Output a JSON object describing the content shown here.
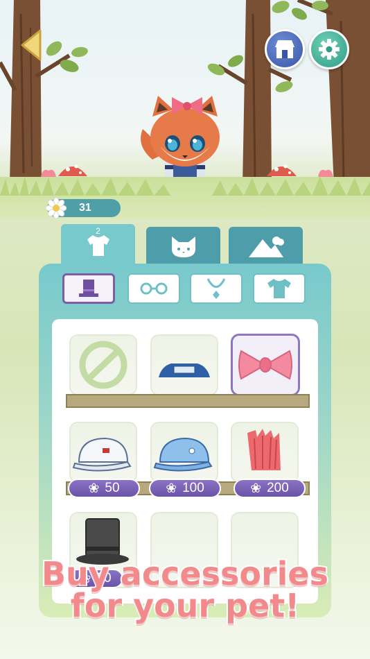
{
  "hud": {
    "coin_count": "31",
    "back_icon": "back-arrow-icon",
    "shop_icon": "shop-icon",
    "settings_icon": "gear-icon"
  },
  "category_tabs": [
    {
      "name": "clothing",
      "icon": "shirt-icon",
      "badge": "2",
      "active": true
    },
    {
      "name": "pet",
      "icon": "cat-face-icon",
      "active": false
    },
    {
      "name": "background",
      "icon": "mountain-icon",
      "active": false
    }
  ],
  "subtabs": [
    {
      "name": "hats",
      "icon": "top-hat-icon",
      "active": true
    },
    {
      "name": "glasses",
      "icon": "glasses-icon",
      "active": false
    },
    {
      "name": "necklaces",
      "icon": "necklace-icon",
      "active": false
    },
    {
      "name": "shirts",
      "icon": "tshirt-icon",
      "active": false
    }
  ],
  "items": [
    {
      "name": "none",
      "icon": "none-icon",
      "price": null
    },
    {
      "name": "headband",
      "icon": "headband-icon",
      "price": null
    },
    {
      "name": "pink-bow",
      "icon": "bow-icon",
      "price": null,
      "selected": true
    },
    {
      "name": "white-cap",
      "icon": "white-cap-icon",
      "price": "50"
    },
    {
      "name": "blue-cap",
      "icon": "blue-cap-icon",
      "price": "100"
    },
    {
      "name": "red-mohawk",
      "icon": "mohawk-icon",
      "price": "200"
    },
    {
      "name": "top-hat",
      "icon": "top-hat-icon",
      "price": "20"
    },
    {
      "name": "locked-slot-1",
      "icon": "",
      "price": null
    },
    {
      "name": "locked-slot-2",
      "icon": "",
      "price": null
    }
  ],
  "promo": {
    "line1": "Buy accessories",
    "line2": "for your pet!"
  },
  "colors": {
    "accent_teal": "#4e9dab",
    "tab_active": "#78c9cc",
    "price_purple": "#7a5ea8",
    "promo_pink": "#f28a8c"
  }
}
